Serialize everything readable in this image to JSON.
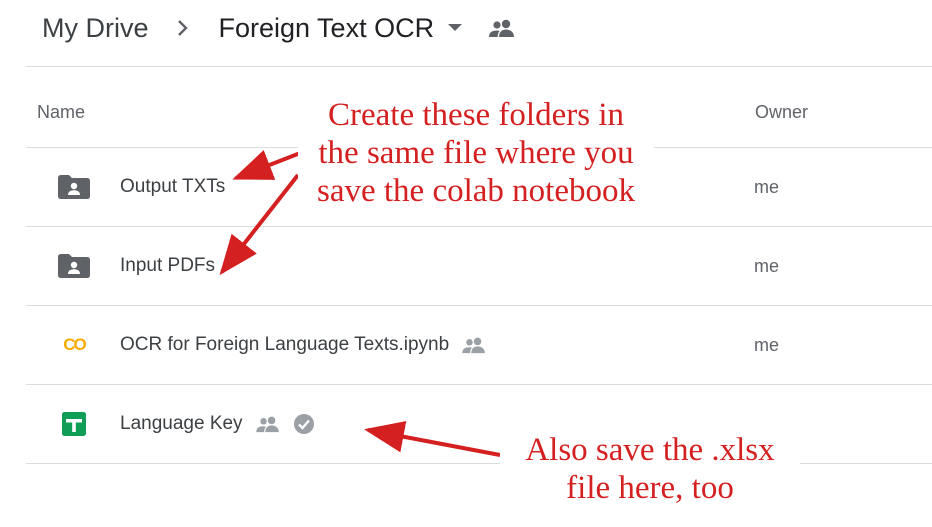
{
  "breadcrumb": {
    "root": "My Drive",
    "current": "Foreign Text OCR"
  },
  "columns": {
    "name": "Name",
    "owner": "Owner"
  },
  "files": [
    {
      "name": "Output TXTs",
      "owner": "me",
      "icon": "shared-folder-icon"
    },
    {
      "name": "Input PDFs",
      "owner": "me",
      "icon": "shared-folder-icon"
    },
    {
      "name": "OCR for Foreign Language Texts.ipynb",
      "owner": "me",
      "icon": "colab-icon",
      "icon_text": "CO"
    },
    {
      "name": "Language Key",
      "owner": "",
      "icon": "google-sheets-icon"
    }
  ],
  "annotations": {
    "folders_note": {
      "line1": "Create these folders in",
      "line2": "the same file where you",
      "line3": "save the colab notebook"
    },
    "xlsx_note": {
      "line1": "Also save the .xlsx",
      "line2": "file here, too"
    }
  },
  "colors": {
    "annotation_red": "#d42020",
    "folder_grey": "#5f6368",
    "colab_orange": "#f9ab00",
    "sheets_green": "#0f9d58",
    "divider": "#dadce0"
  }
}
